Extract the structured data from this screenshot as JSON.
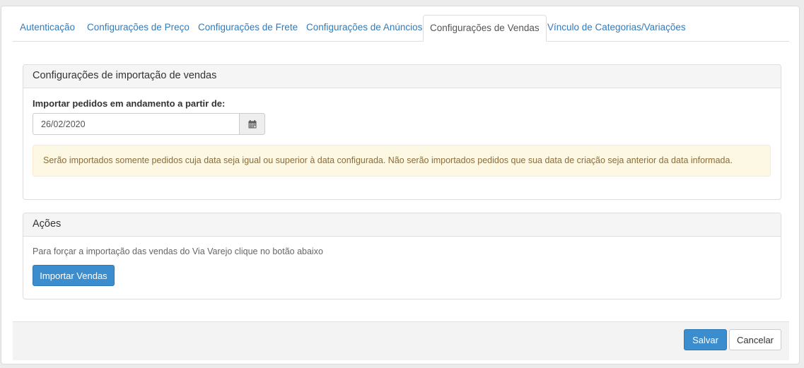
{
  "tabs": [
    {
      "label": "Autenticação",
      "active": false
    },
    {
      "label": "Configurações de Preço",
      "active": false
    },
    {
      "label": "Configurações de Frete",
      "active": false
    },
    {
      "label": "Configurações de Anúncios",
      "active": false
    },
    {
      "label": "Configurações de Vendas",
      "active": true
    },
    {
      "label": "Vínculo de Categorias/Variações",
      "active": false
    }
  ],
  "import_panel": {
    "title": "Configurações de importação de vendas",
    "field_label": "Importar pedidos em andamento a partir de:",
    "date_value": "26/02/2020",
    "alert_text": "Serão importados somente pedidos cuja data seja igual ou superior à data configurada. Não serão importados pedidos que sua data de criação seja anterior da data informada."
  },
  "actions_panel": {
    "title": "Ações",
    "help_text": "Para forçar a importação das vendas do Via Varejo clique no botão abaixo",
    "import_button": "Importar Vendas"
  },
  "footer": {
    "save_label": "Salvar",
    "cancel_label": "Cancelar"
  },
  "icons": {
    "date_picker": "calendar-icon"
  },
  "colors": {
    "link": "#337ab7",
    "primary": "#3c8dcd",
    "alert_bg": "#fcf8e3",
    "alert_text": "#8a6d3b"
  }
}
